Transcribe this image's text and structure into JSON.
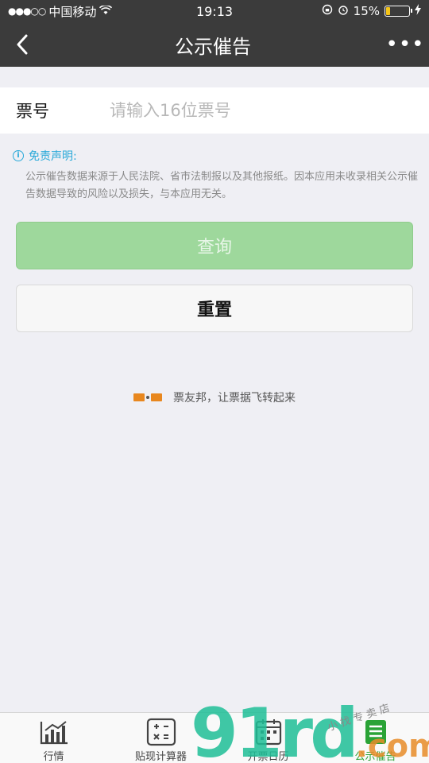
{
  "status_bar": {
    "carrier": "中国移动",
    "time": "19:13",
    "battery_percent": "15%"
  },
  "nav": {
    "title": "公示催告",
    "more_label": "•••"
  },
  "ticket": {
    "label": "票号",
    "placeholder": "请输入16位票号",
    "value": ""
  },
  "disclaimer": {
    "title": "免责声明:",
    "body": "公示催告数据来源于人民法院、省市法制报以及其他报纸。因本应用未收录相关公示催告数据导致的风险以及损失，与本应用无关。"
  },
  "buttons": {
    "query_label": "查询",
    "reset_label": "重置"
  },
  "slogan": "票友邦，让票据飞转起来",
  "tabs": [
    {
      "label": "行情",
      "icon": "chart-icon"
    },
    {
      "label": "贴现计算器",
      "icon": "calculator-icon"
    },
    {
      "label": "开票日历",
      "icon": "calendar-icon"
    },
    {
      "label": "公示催告",
      "icon": "list-icon"
    }
  ],
  "watermark": {
    "main": "91rd",
    "suffix": ".com",
    "small": "小 找 专 卖 店"
  },
  "colors": {
    "navbar_bg": "#3b3b3b",
    "query_button": "#9ed89c",
    "accent_blue": "#29a9d9",
    "tab_active": "#2aa336"
  }
}
